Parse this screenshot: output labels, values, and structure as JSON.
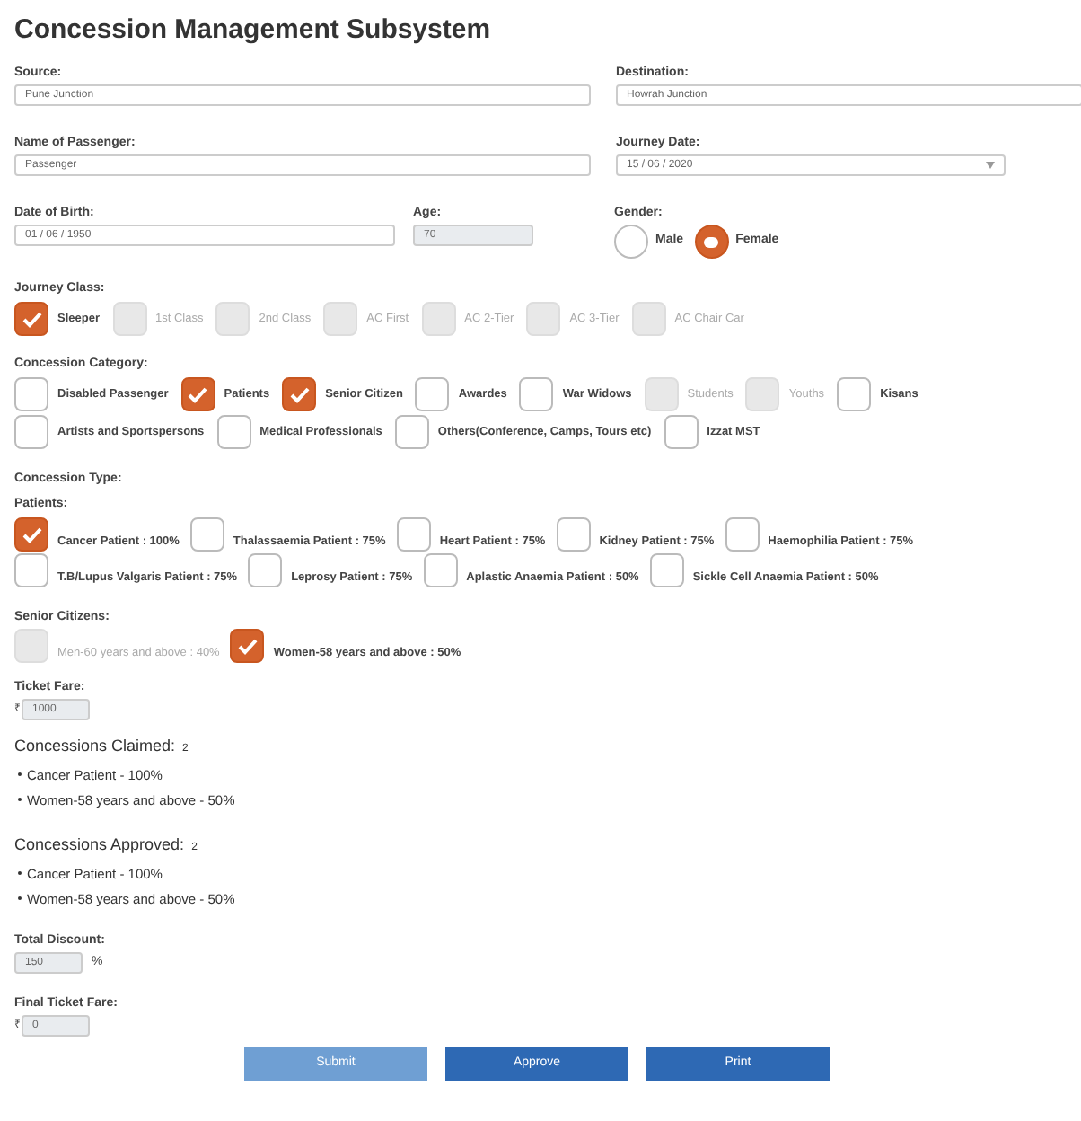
{
  "title": "Concession Management Subsystem",
  "source": {
    "label": "Source:",
    "value": "Pune Junction"
  },
  "destination": {
    "label": "Destination:",
    "value": "Howrah Junction"
  },
  "passenger": {
    "label": "Name of Passenger:",
    "value": "Passenger"
  },
  "journey_date": {
    "label": "Journey Date:",
    "value": "15 / 06 / 2020"
  },
  "dob": {
    "label": "Date of Birth:",
    "value": "01 / 06 / 1950"
  },
  "age": {
    "label": "Age:",
    "value": "70"
  },
  "gender": {
    "label": "Gender:",
    "options": [
      {
        "label": "Male",
        "selected": false
      },
      {
        "label": "Female",
        "selected": true
      }
    ]
  },
  "journey_class": {
    "label": "Journey Class:",
    "items": [
      {
        "label": "Sleeper",
        "checked": true,
        "disabled": false
      },
      {
        "label": "1st Class",
        "checked": false,
        "disabled": true
      },
      {
        "label": "2nd Class",
        "checked": false,
        "disabled": true
      },
      {
        "label": "AC First",
        "checked": false,
        "disabled": true
      },
      {
        "label": "AC 2-Tier",
        "checked": false,
        "disabled": true
      },
      {
        "label": "AC 3-Tier",
        "checked": false,
        "disabled": true
      },
      {
        "label": "AC Chair Car",
        "checked": false,
        "disabled": true
      }
    ]
  },
  "concession_category": {
    "label": "Concession Category:",
    "items": [
      {
        "label": "Disabled Passenger",
        "checked": false,
        "disabled": false
      },
      {
        "label": "Patients",
        "checked": true,
        "disabled": false
      },
      {
        "label": "Senior Citizen",
        "checked": true,
        "disabled": false
      },
      {
        "label": "Awardes",
        "checked": false,
        "disabled": false
      },
      {
        "label": "War Widows",
        "checked": false,
        "disabled": false
      },
      {
        "label": "Students",
        "checked": false,
        "disabled": true
      },
      {
        "label": "Youths",
        "checked": false,
        "disabled": true
      },
      {
        "label": "Kisans",
        "checked": false,
        "disabled": false
      },
      {
        "label": "Artists and Sportspersons",
        "checked": false,
        "disabled": false
      },
      {
        "label": "Medical Professionals",
        "checked": false,
        "disabled": false
      },
      {
        "label": "Others(Conference, Camps, Tours etc)",
        "checked": false,
        "disabled": false
      },
      {
        "label": "Izzat MST",
        "checked": false,
        "disabled": false
      }
    ]
  },
  "concession_type": {
    "label": "Concession Type:",
    "patients": {
      "label": "Patients:",
      "items": [
        {
          "label": "Cancer Patient : 100%",
          "checked": true,
          "disabled": false
        },
        {
          "label": "Thalassaemia Patient : 75%",
          "checked": false,
          "disabled": false
        },
        {
          "label": "Heart Patient : 75%",
          "checked": false,
          "disabled": false
        },
        {
          "label": "Kidney Patient : 75%",
          "checked": false,
          "disabled": false
        },
        {
          "label": "Haemophilia Patient : 75%",
          "checked": false,
          "disabled": false
        },
        {
          "label": "T.B/Lupus Valgaris Patient : 75%",
          "checked": false,
          "disabled": false
        },
        {
          "label": "Leprosy Patient : 75%",
          "checked": false,
          "disabled": false
        },
        {
          "label": "Aplastic Anaemia Patient : 50%",
          "checked": false,
          "disabled": false
        },
        {
          "label": "Sickle Cell Anaemia Patient : 50%",
          "checked": false,
          "disabled": false
        }
      ]
    },
    "senior_citizens": {
      "label": "Senior Citizens:",
      "items": [
        {
          "label": "Men-60 years and above : 40%",
          "checked": false,
          "disabled": true
        },
        {
          "label": "Women-58 years and above : 50%",
          "checked": true,
          "disabled": false
        }
      ]
    }
  },
  "ticket_fare": {
    "label": "Ticket Fare:",
    "prefix": "₹",
    "value": "1000"
  },
  "claimed": {
    "label": "Concessions Claimed:",
    "count": "2",
    "items": [
      "Cancer Patient - 100%",
      "Women-58 years and above - 50%"
    ]
  },
  "approved": {
    "label": "Concessions Approved:",
    "count": "2",
    "items": [
      "Cancer Patient - 100%",
      "Women-58 years and above - 50%"
    ]
  },
  "total_discount": {
    "label": "Total Discount:",
    "value": "150",
    "suffix": "%"
  },
  "final_fare": {
    "label": "Final Ticket Fare:",
    "prefix": "₹",
    "value": "0"
  },
  "buttons": [
    {
      "label": "Submit",
      "disabled": true
    },
    {
      "label": "Approve",
      "disabled": false
    },
    {
      "label": "Print",
      "disabled": false
    }
  ]
}
